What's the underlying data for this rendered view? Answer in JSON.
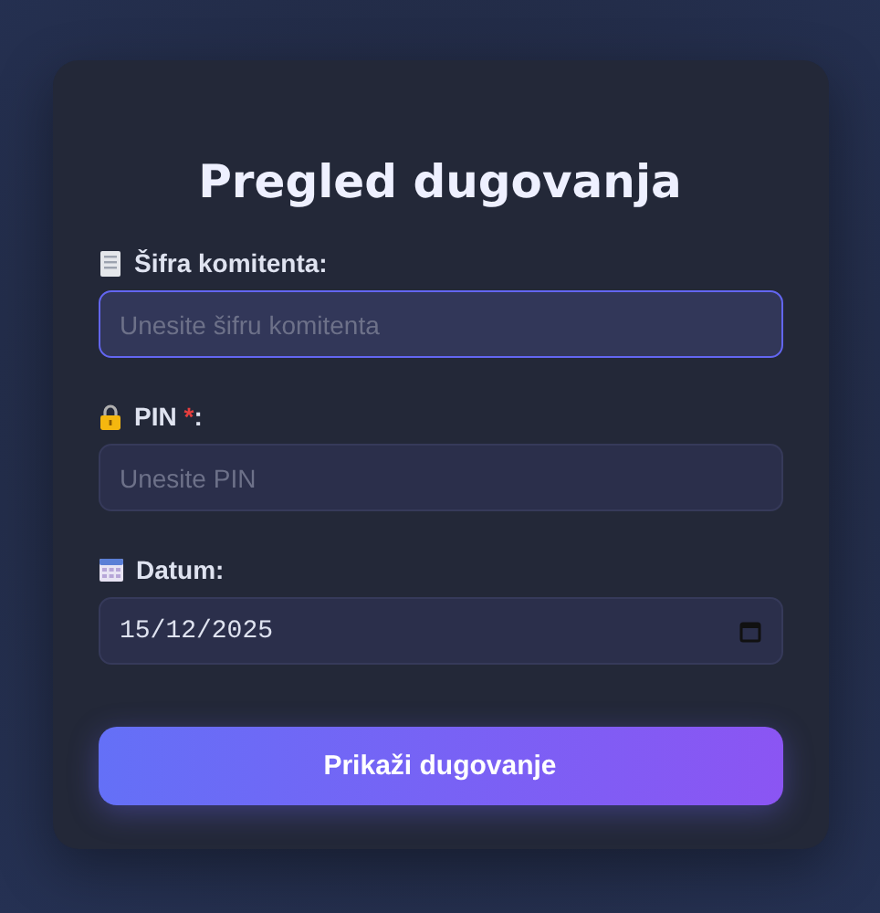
{
  "title": "Pregled dugovanja",
  "fields": [
    {
      "kind": "text",
      "label": "Šifra komitenta:",
      "placeholder": "Unesite šifru komitenta",
      "focused": true
    },
    {
      "kind": "text",
      "label": "PIN ",
      "required_mark": "*",
      "label_end": ":",
      "placeholder": "Unesite PIN",
      "focused": false
    },
    {
      "kind": "date",
      "label": "Datum:",
      "value": "15/12/2025",
      "focused": false
    }
  ],
  "button": "Prikaži dugovanje"
}
